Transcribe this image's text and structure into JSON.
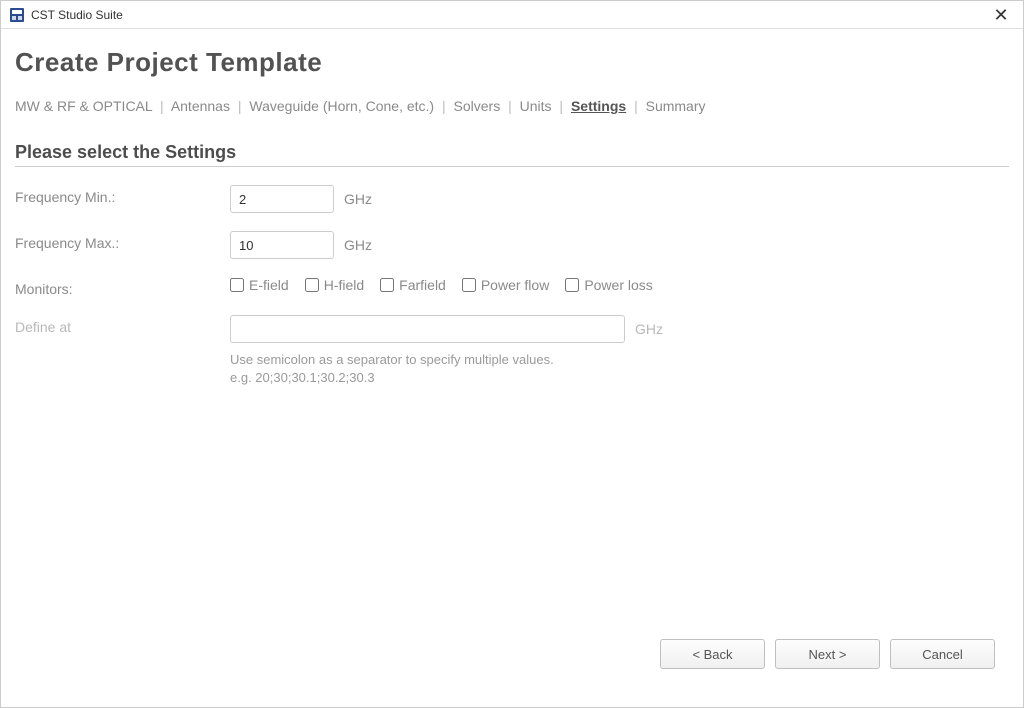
{
  "titlebar": {
    "app_name": "CST Studio Suite"
  },
  "page_title": "Create Project Template",
  "breadcrumb": {
    "items": [
      "MW & RF & OPTICAL",
      "Antennas",
      "Waveguide (Horn, Cone, etc.)",
      "Solvers",
      "Units",
      "Settings",
      "Summary"
    ],
    "current_index": 5
  },
  "section_title": "Please select the Settings",
  "fields": {
    "freq_min": {
      "label": "Frequency Min.:",
      "value": "2",
      "unit": "GHz"
    },
    "freq_max": {
      "label": "Frequency Max.:",
      "value": "10",
      "unit": "GHz"
    },
    "monitors": {
      "label": "Monitors:",
      "options": [
        {
          "label": "E-field"
        },
        {
          "label": "H-field"
        },
        {
          "label": "Farfield"
        },
        {
          "label": "Power flow"
        },
        {
          "label": "Power loss"
        }
      ]
    },
    "define_at": {
      "label": "Define at",
      "value": "",
      "unit": "GHz",
      "hint_line1": "Use semicolon as a separator to specify multiple values.",
      "hint_line2": "e.g. 20;30;30.1;30.2;30.3"
    }
  },
  "buttons": {
    "back": "< Back",
    "next": "Next >",
    "cancel": "Cancel"
  }
}
